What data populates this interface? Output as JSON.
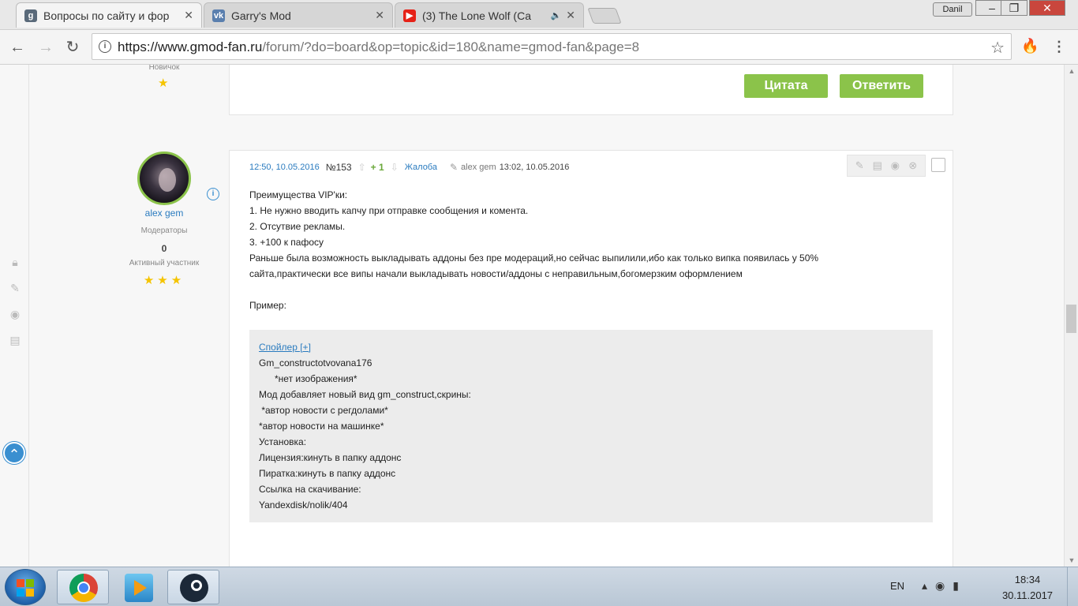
{
  "browser": {
    "tabs": [
      {
        "title": "Вопросы по сайту и фор",
        "favicon": "gmod-fan-icon",
        "color": "#5a6a7a"
      },
      {
        "title": "Garry's Mod",
        "favicon": "vk-icon",
        "color": "#5a7fae"
      },
      {
        "title": "(3) The Lone Wolf (Ca",
        "favicon": "youtube-icon",
        "color": "#e62117"
      }
    ],
    "user_badge": "Danil",
    "url_host": "https://www.gmod-fan.ru",
    "url_path": "/forum/?do=board&op=topic&id=180&name=gmod-fan&page=8"
  },
  "prev_post": {
    "user_rank": "Новичок",
    "star": "★",
    "quote_label": "Цитата",
    "reply_label": "Ответить"
  },
  "post": {
    "author": "alex gem",
    "group": "Модераторы",
    "reputation": "0",
    "status": "Активный участник",
    "stars": "★★★",
    "date": "12:50, 10.05.2016",
    "number": "№153",
    "rating": "+ 1",
    "complaint": "Жалоба",
    "edited_by": "alex gem",
    "edited_time": "13:02, 10.05.2016",
    "lines": [
      "Преимущества VIP'ки:",
      "1. Не нужно вводить капчу при отправке сообщения и комента.",
      "2. Отсутвие рекламы.",
      "3. +100 к пафосу",
      "Раньше была возможность выкладывать аддоны без пре модераций,но сейчас выпилили,ибо как только випка появилась у 50%",
      "сайта,практически все випы начали выкладывать новости/аддоны с неправильным,богомерзким оформлением",
      "",
      "Пример:"
    ],
    "spoiler": {
      "toggle": "Спойлер [+]",
      "lines": [
        "Gm_constructotvovana176",
        "      *нет изображения*",
        "Мод добавляет новый вид gm_construct,скрины:",
        " *автор новости с регдолами*",
        "*автор новости на машинке*",
        "Установка:",
        "Лицензия:кинуть в папку аддонс",
        "Пиратка:кинуть в папку аддонс",
        "Ссылка на скачивание:",
        "Yandexdisk/nolik/404"
      ]
    }
  },
  "taskbar": {
    "lang": "EN",
    "time": "18:34",
    "date": "30.11.2017"
  }
}
